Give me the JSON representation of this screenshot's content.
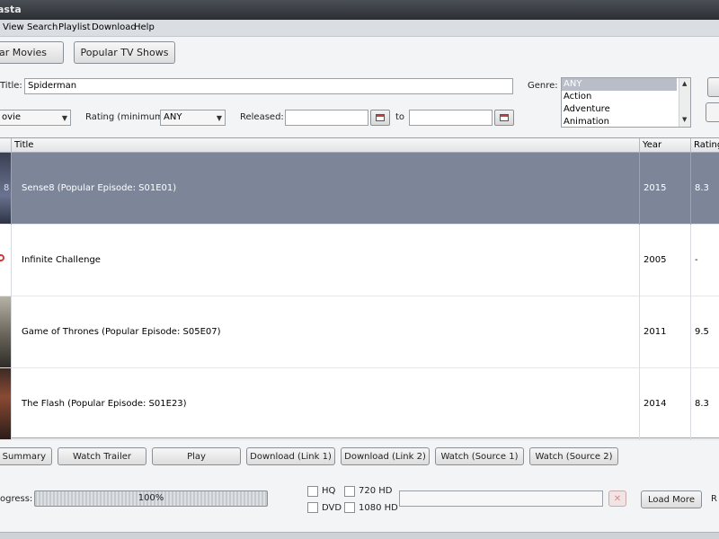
{
  "window": {
    "title": "asta"
  },
  "menu": [
    "View",
    "Search",
    "Playlist",
    "Download",
    "Help"
  ],
  "toolbar": {
    "popular_movies": "ular Movies",
    "popular_tv": "Popular TV Shows"
  },
  "search": {
    "title_label": "Title:",
    "title_value": "Spiderman",
    "genre_label": "Genre:",
    "type_value": "ovie",
    "rating_label": "Rating (minimum):",
    "rating_value": "ANY",
    "released_label": "Released:",
    "released_from": "",
    "to_label": "to",
    "released_to": "",
    "genres": [
      "ANY",
      "Action",
      "Adventure",
      "Animation"
    ],
    "selected_genre": "ANY"
  },
  "table": {
    "columns": {
      "title": "Title",
      "year": "Year",
      "rating": "Rating"
    },
    "rows": [
      {
        "title": "Sense8 (Popular Episode: S01E01)",
        "year": "2015",
        "rating": "8.3",
        "thumb_char": "8"
      },
      {
        "title": "Infinite Challenge",
        "year": "2005",
        "rating": "-"
      },
      {
        "title": "Game of Thrones (Popular Episode: S05E07)",
        "year": "2011",
        "rating": "9.5"
      },
      {
        "title": "The Flash (Popular Episode: S01E23)",
        "year": "2014",
        "rating": "8.3"
      }
    ]
  },
  "actions": {
    "summary": "Summary",
    "watch_trailer": "Watch Trailer",
    "play": "Play",
    "download1": "Download (Link 1)",
    "download2": "Download (Link 2)",
    "watch1": "Watch (Source 1)",
    "watch2": "Watch (Source 2)"
  },
  "bottom": {
    "progress_label": "ogress:",
    "progress_text": "100%",
    "progress": 1.0,
    "hq": "HQ",
    "hd720": "720 HD",
    "dvd": "DVD",
    "hd1080": "1080 HD",
    "load_more": "Load More",
    "trailing": "R"
  },
  "colors": {
    "selected_row": "#7d8699",
    "titlebar": "#2c3035"
  }
}
